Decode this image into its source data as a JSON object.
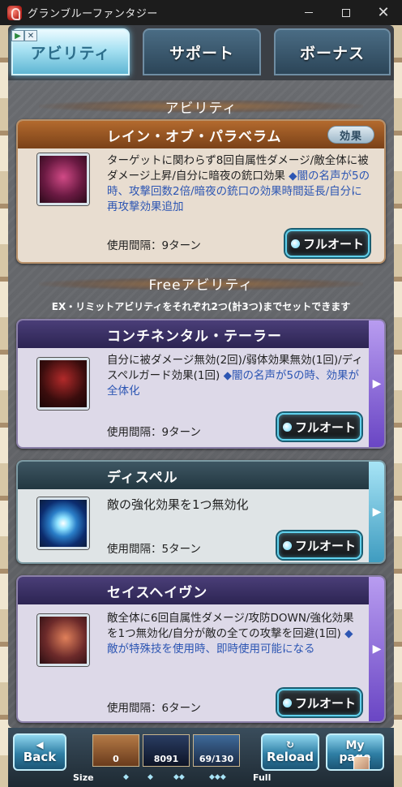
{
  "window": {
    "title": "グランブルーファンタジー"
  },
  "tabs": [
    {
      "label": "アビリティ",
      "active": true
    },
    {
      "label": "サポート",
      "active": false
    },
    {
      "label": "ボーナス",
      "active": false
    }
  ],
  "sections": {
    "ability_header": "アビリティ",
    "free_header": "Freeアビリティ",
    "free_note": "EX・リミットアビリティをそれぞれ2つ(計3つ)までセットできます"
  },
  "cards": [
    {
      "name": "レイン・オブ・パラベラム",
      "badge": "効果",
      "desc_main": "ターゲットに関わらず8回自属性ダメージ/敵全体に被ダメージ上昇/自分に暗夜の銃口効果 ",
      "desc_highlight": "◆闇の名声が5の時、攻撃回数2倍/暗夜の銃口の効果時間延長/自分に再攻撃効果追加",
      "interval": "使用間隔：9ターン",
      "button": "フルオート",
      "icon": "crossed-daggers-icon"
    },
    {
      "name": "コンチネンタル・テーラー",
      "desc_main": "自分に被ダメージ無効(2回)/弱体効果無効(1回)/ディスペルガード効果(1回) ",
      "desc_highlight": "◆闇の名声が5の時、効果が全体化",
      "interval": "使用間隔：9ターン",
      "button": "フルオート",
      "icon": "suit-icon"
    },
    {
      "name": "ディスペル",
      "desc_main": "敵の強化効果を1つ無効化",
      "desc_highlight": "",
      "interval": "使用間隔：5ターン",
      "button": "フルオート",
      "icon": "dispel-orb-icon"
    },
    {
      "name": "セイスヘイヴン",
      "desc_main": "敵全体に6回自属性ダメージ/攻防DOWN/強化効果を1つ無効化/自分が敵の全ての攻撃を回避(1回) ",
      "desc_highlight": "◆敵が特殊技を使用時、即時使用可能になる",
      "interval": "使用間隔：6ターン",
      "button": "フルオート",
      "icon": "blade-icon"
    }
  ],
  "bottom": {
    "back": "Back",
    "reload": "Reload",
    "mypage": "My page",
    "slot1": "0",
    "slot2": "8091",
    "slot3": "69/130",
    "size_label": "Size",
    "full_label": "Full"
  },
  "colors": {
    "accent_tab": "#a7e1f2",
    "highlight_text": "#2d56b3",
    "main_card_header": "#b36a2e",
    "free_card_header": "#4a3e78",
    "dispel_card_header": "#3e5663"
  }
}
